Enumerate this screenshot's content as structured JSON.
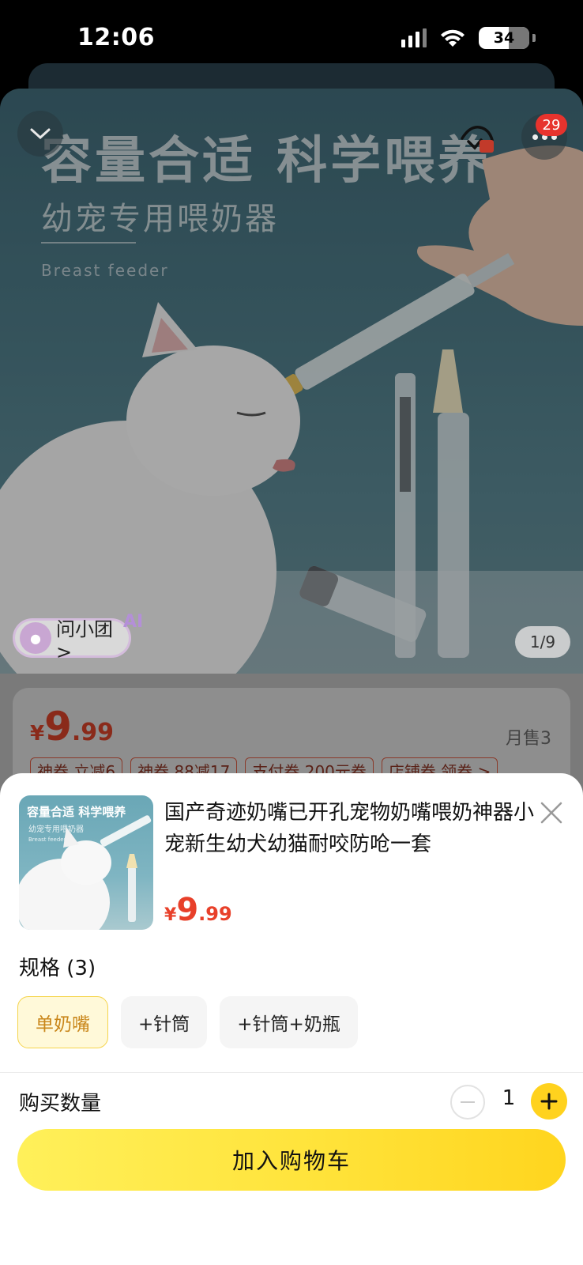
{
  "status_bar": {
    "time": "12:06",
    "battery": "34"
  },
  "hero": {
    "headline": "容量合适  科学喂养",
    "subheadline": "幼宠专用喂奶器",
    "english": "Breast feeder",
    "image_counter": "1/9",
    "ask_button": "问小团>",
    "ai_tag": "AI",
    "more_badge": "29"
  },
  "background_info": {
    "price_currency": "¥",
    "price_int": "9",
    "price_dec": ".99",
    "monthly_sales": "月售3",
    "tags": [
      "神券  立减6",
      "神券  88减17",
      "支付券  200元券",
      "店铺券  领券 >"
    ]
  },
  "sheet": {
    "title": "国产奇迹奶嘴已开孔宠物奶嘴喂奶神器小宠新生幼犬幼猫耐咬防呛一套",
    "thumb_headline": "容量合适  科学喂养",
    "thumb_sub": "幼宠专用喂奶器",
    "thumb_english": "Breast feeder",
    "price_currency": "¥",
    "price_int": "9",
    "price_dec": ".99",
    "spec_label": "规格 (3)",
    "spec_options": [
      "单奶嘴",
      "+针筒",
      "+针筒+奶瓶"
    ],
    "selected_spec_index": 0,
    "quantity_label": "购买数量",
    "quantity": "1",
    "add_to_cart": "加入购物车"
  },
  "colors": {
    "accent_yellow": "#ffd21e",
    "price_red": "#e8402a",
    "badge_red": "#e7332d"
  }
}
